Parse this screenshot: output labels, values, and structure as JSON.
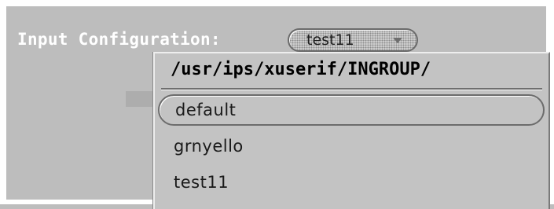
{
  "input_config": {
    "label": "Input Configuration:",
    "selected_value": "test11"
  },
  "menu": {
    "title": "/usr/ips/xuserif/INGROUP/",
    "items": [
      {
        "label": "default",
        "selected": true
      },
      {
        "label": "grnyello",
        "selected": false
      },
      {
        "label": "test11",
        "selected": false
      }
    ]
  },
  "icons": {
    "choice_arrow": "chevron-down-icon"
  },
  "colors": {
    "background": "#bdbdbd",
    "menu_background": "#c3c3c3",
    "label_text": "#ffffff",
    "item_text": "#1a1a1a"
  }
}
